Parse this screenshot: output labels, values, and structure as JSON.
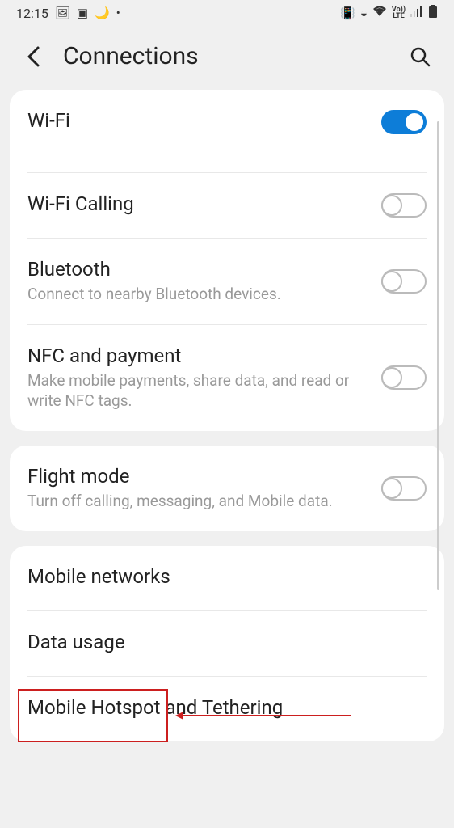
{
  "status": {
    "time": "12:15",
    "volte": "Vo))\nLTE"
  },
  "header": {
    "title": "Connections"
  },
  "items": {
    "wifi": {
      "title": "Wi-Fi"
    },
    "wifiCalling": {
      "title": "Wi-Fi Calling"
    },
    "bluetooth": {
      "title": "Bluetooth",
      "subtitle": "Connect to nearby Bluetooth devices."
    },
    "nfc": {
      "title": "NFC and payment",
      "subtitle": "Make mobile payments, share data, and read or write NFC tags."
    },
    "flight": {
      "title": "Flight mode",
      "subtitle": "Turn off calling, messaging, and Mobile data."
    },
    "mobileNet": {
      "title": "Mobile networks"
    },
    "dataUsage": {
      "title": "Data usage"
    },
    "hotspot": {
      "title": "Mobile Hotspot and Tethering"
    }
  }
}
